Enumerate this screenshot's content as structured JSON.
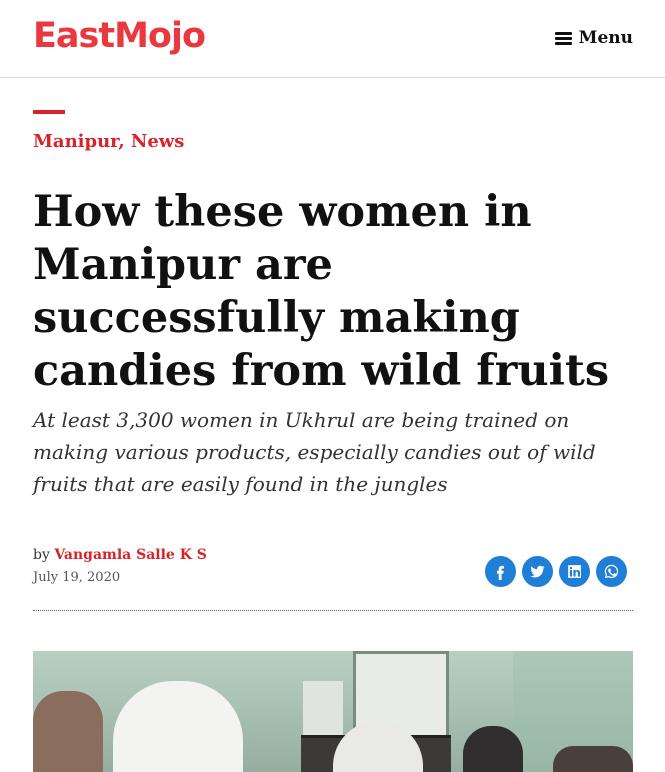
{
  "header": {
    "logo_east": "East",
    "logo_mojo": "Mojo",
    "menu_label": "Menu"
  },
  "article": {
    "categories": [
      {
        "label": "Manipur"
      },
      {
        "label": "News"
      }
    ],
    "category_separator": ", ",
    "headline": "How these women in Manipur are successfully making candies from wild fruits",
    "subtitle": "At least 3,300 women in Ukhrul are being trained on making various products, especially candies out of wild fruits that are easily found in the jungles",
    "byline_prefix": "by",
    "author": "Vangamla Salle K S",
    "date": "July 19, 2020"
  },
  "share": {
    "buttons": [
      {
        "icon": "facebook-icon"
      },
      {
        "icon": "twitter-icon"
      },
      {
        "icon": "linkedin-icon"
      },
      {
        "icon": "whatsapp-icon"
      }
    ]
  },
  "colors": {
    "brand_red": "#d8232a",
    "share_blue": "#1f7fd6"
  }
}
